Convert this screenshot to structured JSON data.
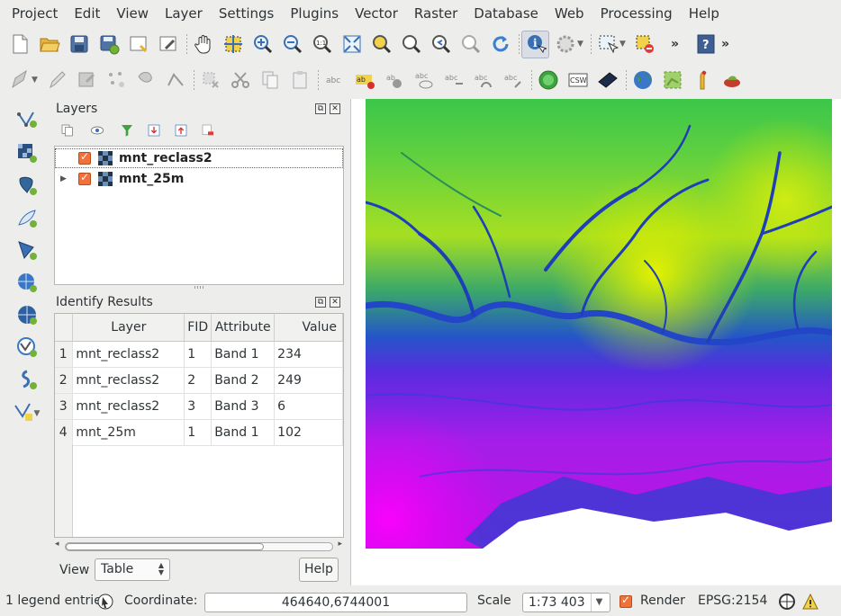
{
  "menu": [
    "Project",
    "Edit",
    "View",
    "Layer",
    "Settings",
    "Plugins",
    "Vector",
    "Raster",
    "Database",
    "Web",
    "Processing",
    "Help"
  ],
  "layers_panel": {
    "title": "Layers",
    "layers": [
      {
        "name": "mnt_reclass2",
        "checked": true,
        "expandable": false
      },
      {
        "name": "mnt_25m",
        "checked": true,
        "expandable": true
      }
    ]
  },
  "identify_panel": {
    "title": "Identify Results",
    "columns": [
      "Layer",
      "FID",
      "Attribute",
      "Value"
    ],
    "rows": [
      {
        "n": "1",
        "layer": "mnt_reclass2",
        "fid": "1",
        "attr": "Band 1",
        "value": "234"
      },
      {
        "n": "2",
        "layer": "mnt_reclass2",
        "fid": "2",
        "attr": "Band 2",
        "value": "249"
      },
      {
        "n": "3",
        "layer": "mnt_reclass2",
        "fid": "3",
        "attr": "Band 3",
        "value": "6"
      },
      {
        "n": "4",
        "layer": "mnt_25m",
        "fid": "1",
        "attr": "Band 1",
        "value": "102"
      }
    ],
    "view_label": "View",
    "view_value": "Table",
    "help_label": "Help"
  },
  "statusbar": {
    "legend_text": "1 legend entrie",
    "coordinate_label": "Coordinate:",
    "coordinate_value": "464640,6744001",
    "scale_label": "Scale",
    "scale_value": "1:73 403",
    "render_label": "Render",
    "render_checked": true,
    "crs": "EPSG:2154"
  },
  "colors": {
    "accent_checkbox": "#f0723a",
    "map_high": "#c8e600",
    "map_mid": "#1846c8",
    "map_low": "#d000f0"
  }
}
